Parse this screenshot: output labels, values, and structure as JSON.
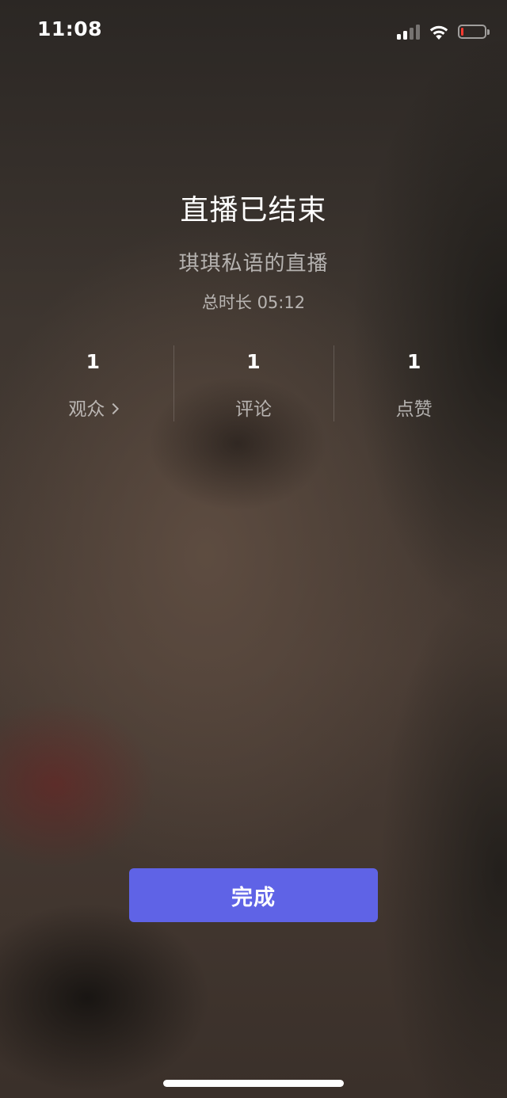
{
  "status_bar": {
    "time": "11:08",
    "signal_bars_active": 2,
    "signal_bars_total": 4,
    "battery_level_fraction": 0.12,
    "battery_color": "#ff3b30"
  },
  "end_screen": {
    "title": "直播已结束",
    "streamer_line": "琪琪私语的直播",
    "duration_text": "总时长 05:12"
  },
  "stats": [
    {
      "value": "1",
      "label": "观众",
      "has_chevron": true
    },
    {
      "value": "1",
      "label": "评论",
      "has_chevron": false
    },
    {
      "value": "1",
      "label": "点赞",
      "has_chevron": false
    }
  ],
  "done_button": {
    "label": "完成",
    "color": "#5f63e6"
  }
}
